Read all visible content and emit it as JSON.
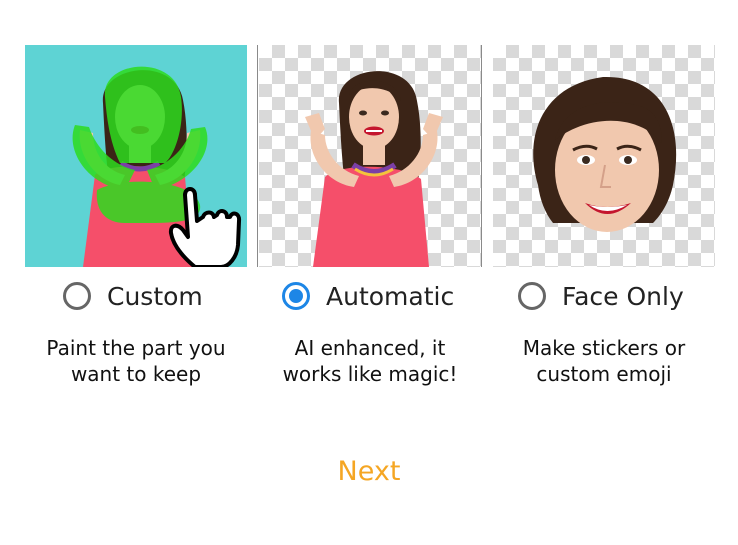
{
  "options": [
    {
      "label": "Custom",
      "selected": false,
      "description": [
        "Paint the part you",
        "want to keep"
      ],
      "icon": "hand-pointer-icon"
    },
    {
      "label": "Automatic",
      "selected": true,
      "description": [
        "AI enhanced, it",
        "works like magic!"
      ]
    },
    {
      "label": "Face Only",
      "selected": false,
      "description": [
        "Make stickers or",
        "custom emoji"
      ]
    }
  ],
  "next_label": "Next",
  "colors": {
    "accent": "#f5a623",
    "radio_selected": "#1d86e6",
    "radio_unselected": "#666666",
    "custom_bg": "#5ed3d4",
    "paint_mask": "#2ddc1e"
  }
}
